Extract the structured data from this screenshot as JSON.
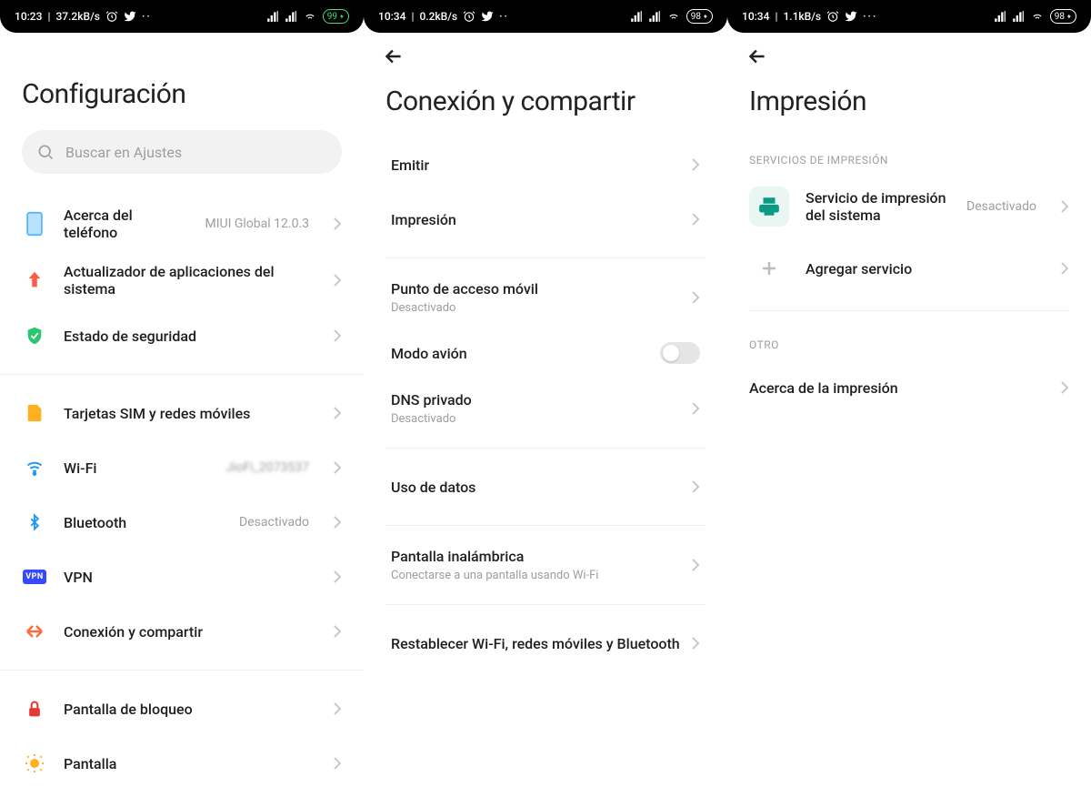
{
  "phones": {
    "p1": {
      "status": {
        "time": "10:23",
        "speed": "37.2kB/s",
        "battery": "99"
      },
      "title": "Configuración",
      "search_placeholder": "Buscar en Ajustes",
      "group1": [
        {
          "label": "Acerca del teléfono",
          "value": "MIUI Global 12.0.3",
          "icon": "phone"
        },
        {
          "label": "Actualizador de aplicaciones del sistema",
          "icon": "upload"
        },
        {
          "label": "Estado de seguridad",
          "icon": "shield"
        }
      ],
      "group2": [
        {
          "label": "Tarjetas SIM y redes móviles",
          "icon": "sim"
        },
        {
          "label": "Wi-Fi",
          "value": "JioFi_2073537",
          "value_blur": true,
          "icon": "wifi"
        },
        {
          "label": "Bluetooth",
          "value": "Desactivado",
          "icon": "bluetooth"
        },
        {
          "label": "VPN",
          "icon": "vpn"
        },
        {
          "label": "Conexión y compartir",
          "icon": "share"
        }
      ],
      "group3": [
        {
          "label": "Pantalla de bloqueo",
          "icon": "lock"
        },
        {
          "label": "Pantalla",
          "icon": "sun"
        }
      ]
    },
    "p2": {
      "status": {
        "time": "10:34",
        "speed": "0.2kB/s",
        "battery": "98"
      },
      "title": "Conexión y compartir",
      "rows": [
        {
          "label": "Emitir",
          "type": "nav"
        },
        {
          "label": "Impresión",
          "type": "nav"
        },
        {
          "sep": true
        },
        {
          "label": "Punto de acceso móvil",
          "sub": "Desactivado",
          "type": "nav"
        },
        {
          "label": "Modo avión",
          "type": "toggle"
        },
        {
          "label": "DNS privado",
          "sub": "Desactivado",
          "type": "nav"
        },
        {
          "sep": true
        },
        {
          "label": "Uso de datos",
          "type": "nav"
        },
        {
          "sep": true
        },
        {
          "label": "Pantalla inalámbrica",
          "sub": "Conectarse a una pantalla usando Wi-Fi",
          "type": "nav"
        },
        {
          "sep": true
        },
        {
          "label": "Restablecer Wi-Fi, redes móviles y Bluetooth",
          "type": "nav"
        }
      ]
    },
    "p3": {
      "status": {
        "time": "10:34",
        "speed": "1.1kB/s",
        "battery": "98"
      },
      "title": "Impresión",
      "section1": {
        "header": "SERVICIOS DE IMPRESIÓN",
        "printer_label": "Servicio de impresión del sistema",
        "printer_value": "Desactivado",
        "add_label": "Agregar servicio"
      },
      "section2": {
        "header": "OTRO",
        "about_label": "Acerca de la impresión"
      }
    }
  }
}
